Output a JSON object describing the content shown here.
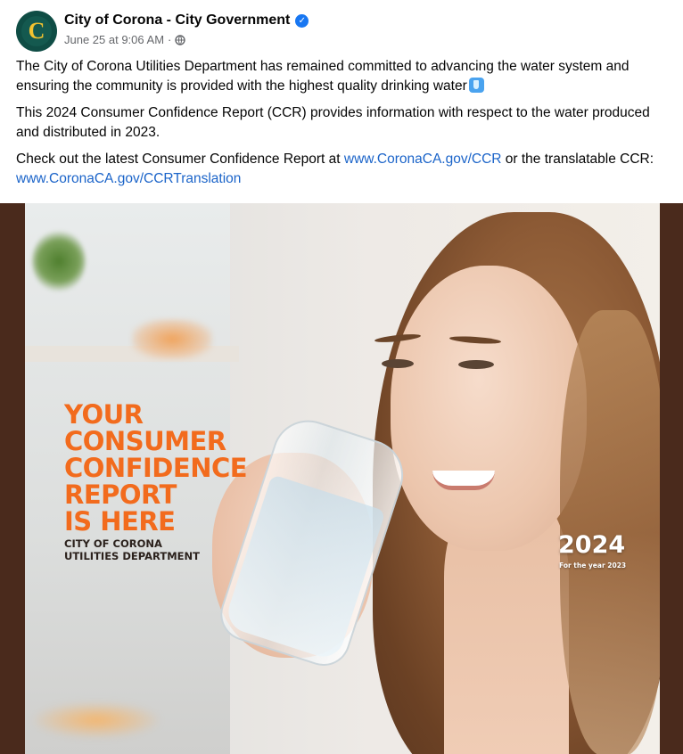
{
  "post": {
    "page_name": "City of Corona - City Government",
    "avatar_letter": "C",
    "timestamp": "June 25 at 9:06 AM",
    "separator": "·",
    "paragraph_1": "The City of Corona Utilities Department has remained committed to advancing the water system and ensuring the community is provided with the highest quality drinking water",
    "paragraph_2": "This 2024 Consumer Confidence Report (CCR) provides information with respect to the water produced and distributed in 2023.",
    "paragraph_3_prefix": " Check out the latest Consumer Confidence Report at ",
    "link_1": "www.CoronaCA.gov/CCR",
    "paragraph_3_middle": " or the translatable CCR: ",
    "link_2": "www.CoronaCA.gov/CCRTranslation"
  },
  "image": {
    "headline_lines": [
      "YOUR",
      "CONSUMER",
      "CONFIDENCE",
      "REPORT",
      "IS HERE"
    ],
    "dept_line_1": "CITY OF CORONA",
    "dept_line_2": "UTILITIES DEPARTMENT",
    "year": "2024",
    "year_sub": "For the year 2023"
  },
  "colors": {
    "headline": "#f26b1d",
    "link": "#1b64c9",
    "verified": "#1877f2",
    "avatar_bg": "#0f4d45"
  },
  "icons": [
    "verified-badge-icon",
    "globe-icon",
    "water-emoji-icon"
  ]
}
